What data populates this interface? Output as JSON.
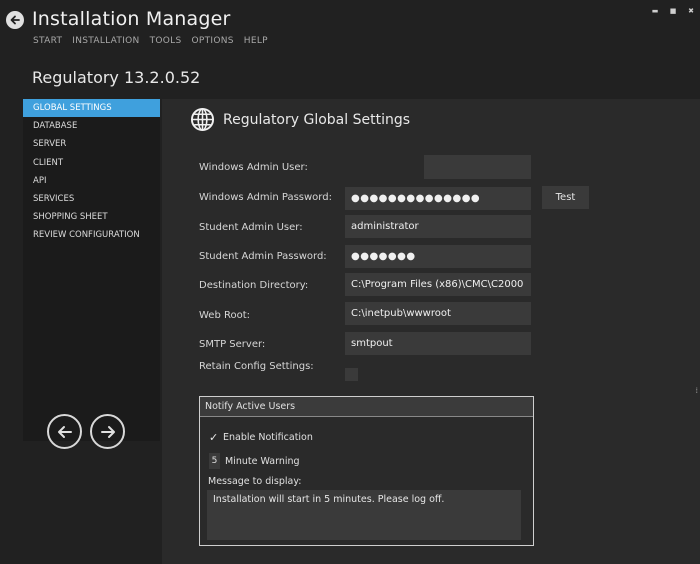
{
  "window": {
    "title": "Installation Manager",
    "controls": [
      "minimize-icon",
      "maximize-icon",
      "close-icon"
    ]
  },
  "menu": [
    "START",
    "INSTALLATION",
    "TOOLS",
    "OPTIONS",
    "HELP"
  ],
  "version": "Regulatory 13.2.0.52",
  "sidebar": {
    "items": [
      {
        "label": "GLOBAL SETTINGS",
        "active": true
      },
      {
        "label": "DATABASE",
        "active": false
      },
      {
        "label": "SERVER",
        "active": false
      },
      {
        "label": "CLIENT",
        "active": false
      },
      {
        "label": "API",
        "active": false
      },
      {
        "label": "SERVICES",
        "active": false
      },
      {
        "label": "SHOPPING SHEET",
        "active": false
      },
      {
        "label": "REVIEW CONFIGURATION",
        "active": false
      }
    ]
  },
  "section": {
    "title": "Regulatory Global Settings",
    "icon": "globe-icon"
  },
  "form": {
    "windows_admin_user": {
      "label": "Windows Admin User:",
      "value": ""
    },
    "windows_admin_password": {
      "label": "Windows Admin Password:",
      "value": "●●●●●●●●●●●●●●"
    },
    "test_button": "Test",
    "student_admin_user": {
      "label": "Student Admin User:",
      "value": "administrator"
    },
    "student_admin_password": {
      "label": "Student Admin Password:",
      "value": "●●●●●●●"
    },
    "destination_directory": {
      "label": "Destination Directory:",
      "value": "C:\\Program Files (x86)\\CMC\\C2000"
    },
    "web_root": {
      "label": "Web Root:",
      "value": "C:\\inetpub\\wwwroot"
    },
    "smtp_server": {
      "label": "SMTP Server:",
      "value": "smtpout"
    },
    "retain_config": {
      "label": "Retain Config Settings:",
      "checked": false
    }
  },
  "notify": {
    "title": "Notify Active Users",
    "enable_label": "Enable Notification",
    "enable_checked": true,
    "minutes_value": "5",
    "minutes_label": "Minute Warning",
    "message_label": "Message to display:",
    "message_value": "Installation will start in 5 minutes. Please log off."
  },
  "colors": {
    "accent": "#3fa0dd",
    "background": "#212121",
    "panel": "#2a2a2a",
    "field": "#3a3a3a"
  }
}
